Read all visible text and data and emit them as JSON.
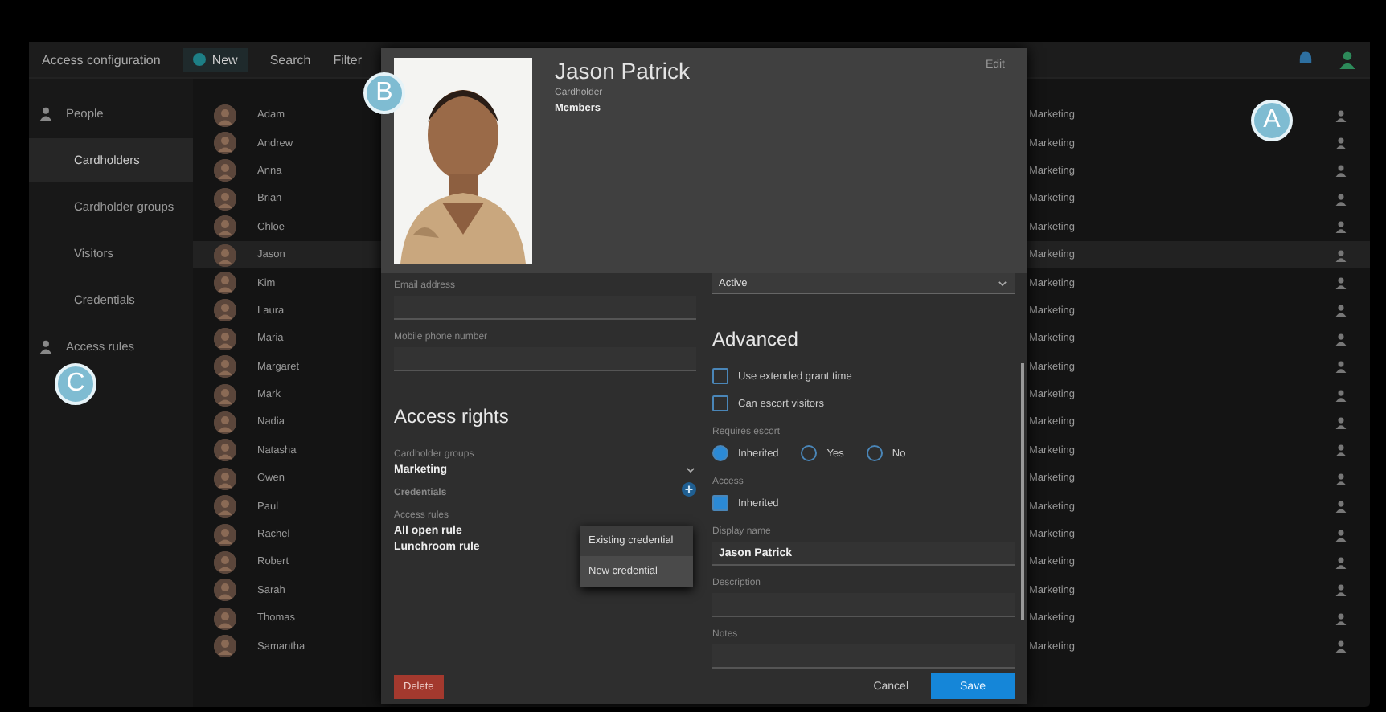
{
  "topbar": {
    "title": "Access configuration",
    "new_button": "New",
    "items": [
      "Search",
      "Filter"
    ]
  },
  "sidebar": {
    "items": [
      {
        "label": "People",
        "kind": "section",
        "selected": false
      },
      {
        "label": "Cardholders",
        "kind": "item",
        "selected": true
      },
      {
        "label": "Cardholder groups",
        "kind": "item",
        "selected": false
      },
      {
        "label": "Visitors",
        "kind": "item",
        "selected": false
      },
      {
        "label": "Credentials",
        "kind": "item",
        "selected": false
      },
      {
        "label": "Access rules",
        "kind": "section",
        "selected": false
      }
    ]
  },
  "list": {
    "rows": [
      {
        "name": "Adam",
        "group": "Marketing",
        "selected": false
      },
      {
        "name": "Andrew",
        "group": "Marketing",
        "selected": false
      },
      {
        "name": "Anna",
        "group": "Marketing",
        "selected": false
      },
      {
        "name": "Brian",
        "group": "Marketing",
        "selected": false
      },
      {
        "name": "Chloe",
        "group": "Marketing",
        "selected": false
      },
      {
        "name": "Jason",
        "group": "Marketing",
        "selected": true
      },
      {
        "name": "Kim",
        "group": "Marketing",
        "selected": false
      },
      {
        "name": "Laura",
        "group": "Marketing",
        "selected": false
      },
      {
        "name": "Maria",
        "group": "Marketing",
        "selected": false
      },
      {
        "name": "Margaret",
        "group": "Marketing",
        "selected": false
      },
      {
        "name": "Mark",
        "group": "Marketing",
        "selected": false
      },
      {
        "name": "Nadia",
        "group": "Marketing",
        "selected": false
      },
      {
        "name": "Natasha",
        "group": "Marketing",
        "selected": false
      },
      {
        "name": "Owen",
        "group": "Marketing",
        "selected": false
      },
      {
        "name": "Paul",
        "group": "Marketing",
        "selected": false
      },
      {
        "name": "Rachel",
        "group": "Marketing",
        "selected": false
      },
      {
        "name": "Robert",
        "group": "Marketing",
        "selected": false
      },
      {
        "name": "Sarah",
        "group": "Marketing",
        "selected": false
      },
      {
        "name": "Thomas",
        "group": "Marketing",
        "selected": false
      },
      {
        "name": "Samantha",
        "group": "Marketing",
        "selected": false
      }
    ]
  },
  "dialog": {
    "name": "Jason Patrick",
    "subtitle": "Cardholder",
    "status": "Members",
    "edit_button": "Edit",
    "top_select": {
      "value": "Active"
    },
    "left_fields": [
      {
        "label": "Email address"
      },
      {
        "label": "Mobile phone number"
      }
    ],
    "access_rights": {
      "heading": "Access rights",
      "groups_label": "Cardholder groups",
      "groups_value": "Marketing",
      "credentials_label": "Credentials",
      "rules_label": "Access rules",
      "rules": [
        "All open rule",
        "Lunchroom rule"
      ],
      "menu": [
        {
          "label": "Existing credential",
          "selected": false
        },
        {
          "label": "New credential",
          "selected": true
        }
      ]
    },
    "advanced": {
      "heading": "Advanced",
      "checks": [
        {
          "label": "Use extended grant time",
          "checked": false
        },
        {
          "label": "Can escort visitors",
          "checked": false
        }
      ],
      "radio_label": "Requires escort",
      "radios": [
        {
          "label": "Inherited",
          "selected": true
        },
        {
          "label": "Yes",
          "selected": false
        },
        {
          "label": "No",
          "selected": false
        }
      ],
      "inherit_label": "Access",
      "inherit": {
        "label": "Inherited",
        "checked": true
      },
      "fields": [
        {
          "label": "Display name",
          "value": "Jason Patrick"
        },
        {
          "label": "Description"
        },
        {
          "label": "Notes"
        }
      ]
    },
    "footer": {
      "delete": "Delete",
      "cancel": "Cancel",
      "save": "Save"
    }
  },
  "callouts": [
    {
      "letter": "A",
      "kind": "a"
    },
    {
      "letter": "B",
      "kind": "b"
    },
    {
      "letter": "C",
      "kind": "c"
    }
  ]
}
